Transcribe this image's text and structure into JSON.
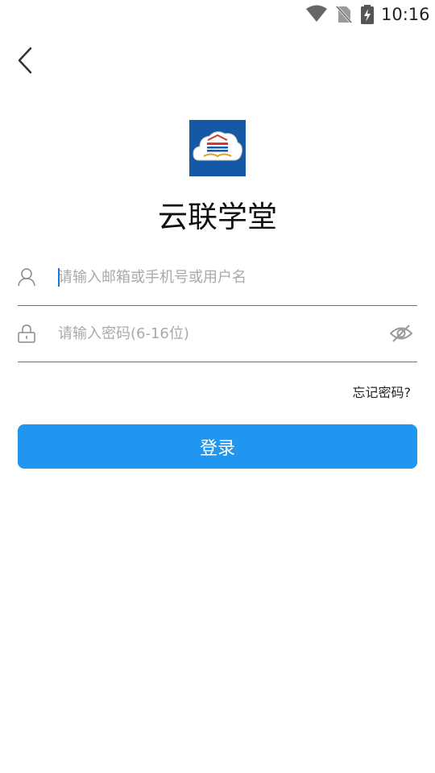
{
  "status_bar": {
    "time": "10:16",
    "icons": [
      "wifi-icon",
      "no-sim-icon",
      "battery-charging-icon"
    ]
  },
  "nav": {
    "back_icon": "back-arrow-icon"
  },
  "app": {
    "logo_icon": "cloud-book-logo",
    "title": "云联学堂",
    "colors": {
      "accent": "#2196f0",
      "underline": "#1a8fc6",
      "logo_bg": "#1558a6"
    }
  },
  "form": {
    "username": {
      "icon": "user-icon",
      "value": "",
      "placeholder": "请输入邮箱或手机号或用户名"
    },
    "password": {
      "icon": "lock-icon",
      "value": "",
      "placeholder": "请输入密码(6-16位)",
      "toggle_icon": "eye-off-icon"
    },
    "forgot_label": "忘记密码?",
    "login_label": "登录"
  }
}
